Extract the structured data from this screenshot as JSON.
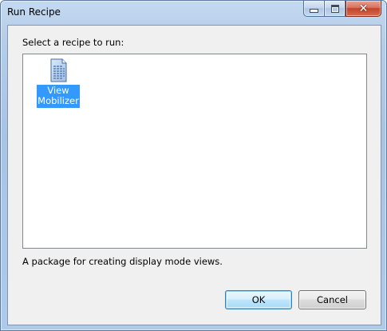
{
  "window": {
    "title": "Run Recipe",
    "caption_buttons": {
      "minimize_icon": "minimize-icon",
      "maximize_icon": "maximize-icon",
      "close_glyph": "✕"
    }
  },
  "dialog": {
    "prompt": "Select a recipe to run:",
    "recipes": [
      {
        "label_line1": "View",
        "label_line2": "Mobilizer",
        "icon": "document-icon",
        "selected": true
      }
    ],
    "description": "A package for creating display mode views.",
    "ok_label": "OK",
    "cancel_label": "Cancel"
  },
  "colors": {
    "selection": "#3399ff",
    "frame": "#aecaeb",
    "close_button": "#c2432a"
  }
}
